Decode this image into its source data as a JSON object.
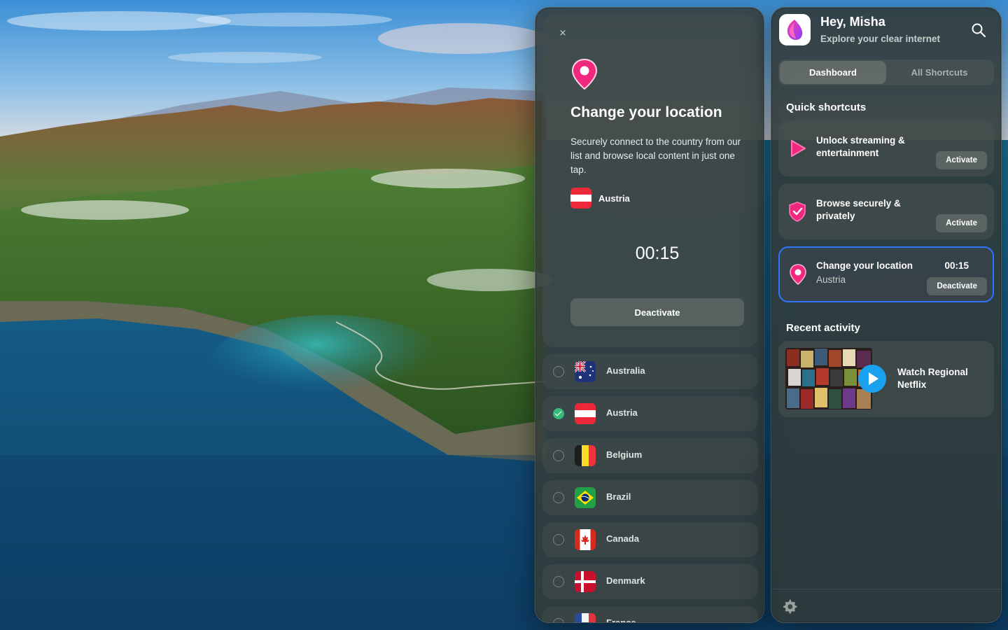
{
  "colors": {
    "accent_pink": "#f0287e",
    "accent_blue": "#2f73ff",
    "check_green": "#37b979",
    "play_blue": "#1aa2f0"
  },
  "location_panel": {
    "close_icon": "×",
    "title": "Change your location",
    "description": "Securely connect to the country from our list and browse local content in just one tap.",
    "selected_country": "Austria",
    "timer": "00:15",
    "deactivate_label": "Deactivate",
    "countries": [
      {
        "name": "Australia",
        "flag": "australia-flag-icon",
        "checked": false
      },
      {
        "name": "Austria",
        "flag": "austria-flag-icon",
        "checked": true
      },
      {
        "name": "Belgium",
        "flag": "belgium-flag-icon",
        "checked": false
      },
      {
        "name": "Brazil",
        "flag": "brazil-flag-icon",
        "checked": false
      },
      {
        "name": "Canada",
        "flag": "canada-flag-icon",
        "checked": false
      },
      {
        "name": "Denmark",
        "flag": "denmark-flag-icon",
        "checked": false
      },
      {
        "name": "France",
        "flag": "france-flag-icon",
        "checked": false
      }
    ]
  },
  "dashboard": {
    "greeting": "Hey, Misha",
    "subtitle": "Explore your clear internet",
    "tabs": [
      {
        "label": "Dashboard",
        "active": true
      },
      {
        "label": "All Shortcuts",
        "active": false
      }
    ],
    "quick_shortcuts_title": "Quick shortcuts",
    "shortcuts": [
      {
        "title": "Unlock streaming & entertainment",
        "button": "Activate",
        "icon": "play-icon"
      },
      {
        "title": "Browse securely & privately",
        "button": "Activate",
        "icon": "shield-check-icon"
      },
      {
        "title": "Change your location",
        "subtitle": "Austria",
        "time": "00:15",
        "button": "Deactivate",
        "icon": "location-pin-icon",
        "active": true
      }
    ],
    "recent_activity_title": "Recent activity",
    "recent_activity": [
      {
        "title": "Watch Regional Netflix"
      }
    ]
  }
}
